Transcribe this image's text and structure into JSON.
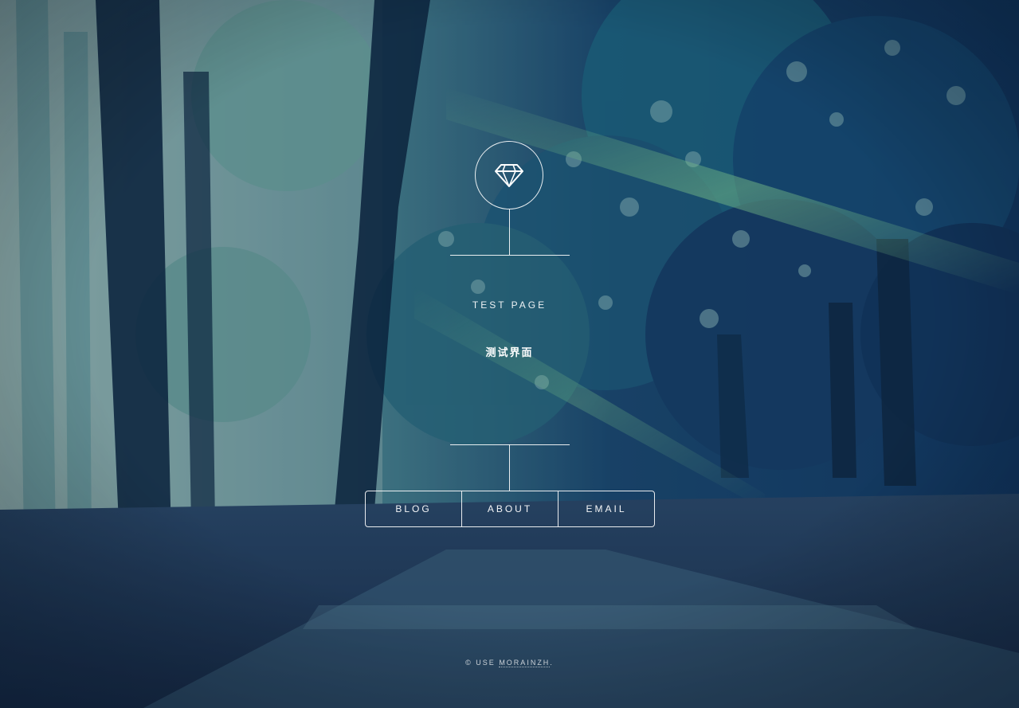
{
  "header": {
    "icon": "diamond-icon",
    "title": "TEST PAGE",
    "subtitle": "测试界面"
  },
  "nav": {
    "items": [
      {
        "label": "BLOG"
      },
      {
        "label": "ABOUT"
      },
      {
        "label": "EMAIL"
      }
    ]
  },
  "footer": {
    "copyright": "© USE",
    "link_label": "MORAINZH",
    "suffix": "."
  },
  "colors": {
    "line": "#ffffff",
    "forest_dark": "#0e2240",
    "forest_mid": "#1d5f7a",
    "forest_light": "#6aa8a8",
    "light_ray": "#7fd48a"
  }
}
